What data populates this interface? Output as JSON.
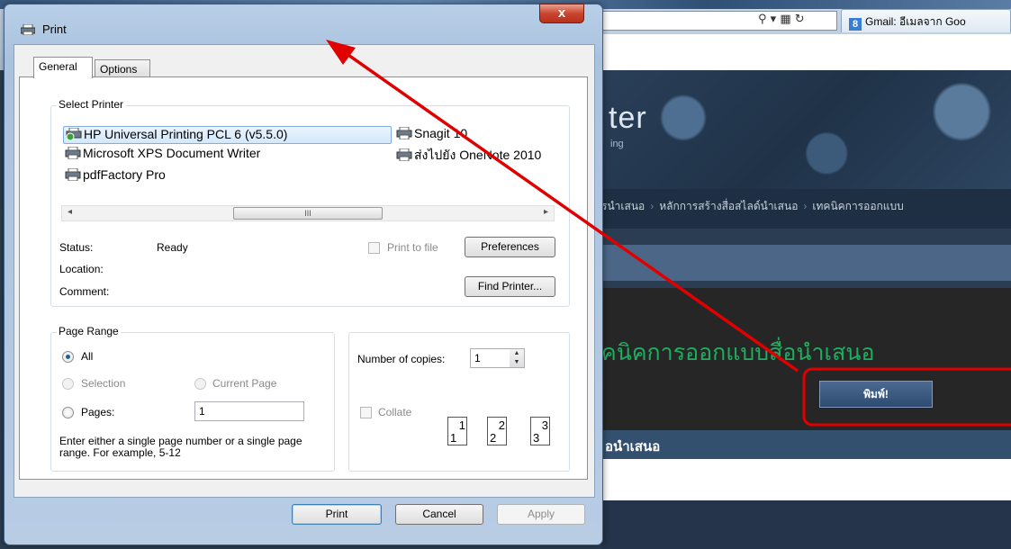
{
  "browser": {
    "tab_title": "Gmail: อีเมลจาก Goo",
    "banner_title": "ter",
    "banner_subtitle": "ing",
    "nav_items": [
      "รนำเสนอ",
      "หลักการสร้างสื่อสไลด์นำเสนอ",
      "เทคนิคการออกแบบ"
    ],
    "page_heading": "คนิคการออกแบบสื่อนำเสนอ",
    "print_button_label": "พิมพ์!",
    "section_heading": "อนำเสนอ"
  },
  "dialog": {
    "title": "Print",
    "close_label": "x",
    "tabs": [
      {
        "label": "General",
        "active": true
      },
      {
        "label": "Options",
        "active": false
      }
    ],
    "select_printer": {
      "legend": "Select Printer",
      "printers": [
        {
          "name": "HP Universal Printing PCL 6 (v5.5.0)",
          "selected": true
        },
        {
          "name": "Microsoft XPS Document Writer",
          "selected": false
        },
        {
          "name": "pdfFactory Pro",
          "selected": false
        },
        {
          "name": "Snagit 10",
          "selected": false
        },
        {
          "name": "ส่งไปยัง OneNote 2010",
          "selected": false
        }
      ],
      "scroll_thumb_label": "III",
      "status_label": "Status:",
      "status_value": "Ready",
      "location_label": "Location:",
      "location_value": "",
      "comment_label": "Comment:",
      "comment_value": "",
      "print_to_file_label": "Print to file",
      "preferences_label": "Preferences",
      "find_printer_label": "Find Printer..."
    },
    "page_range": {
      "legend": "Page Range",
      "all_label": "All",
      "selection_label": "Selection",
      "current_page_label": "Current Page",
      "pages_label": "Pages:",
      "pages_value": "1",
      "selected_option": "All",
      "help_text": "Enter either a single page number or a single page range.  For example, 5-12"
    },
    "copies": {
      "number_label": "Number of copies:",
      "number_value": "1",
      "collate_label": "Collate",
      "collate_pages": [
        {
          "n": "1",
          "s": "1"
        },
        {
          "n": "2",
          "s": "2"
        },
        {
          "n": "3",
          "s": "3"
        }
      ]
    },
    "buttons": {
      "print_label": "Print",
      "cancel_label": "Cancel",
      "apply_label": "Apply"
    }
  },
  "colors": {
    "annotation_red": "#e00000",
    "selection_blue": "#84acdd",
    "heading_green": "#1dae5e"
  }
}
